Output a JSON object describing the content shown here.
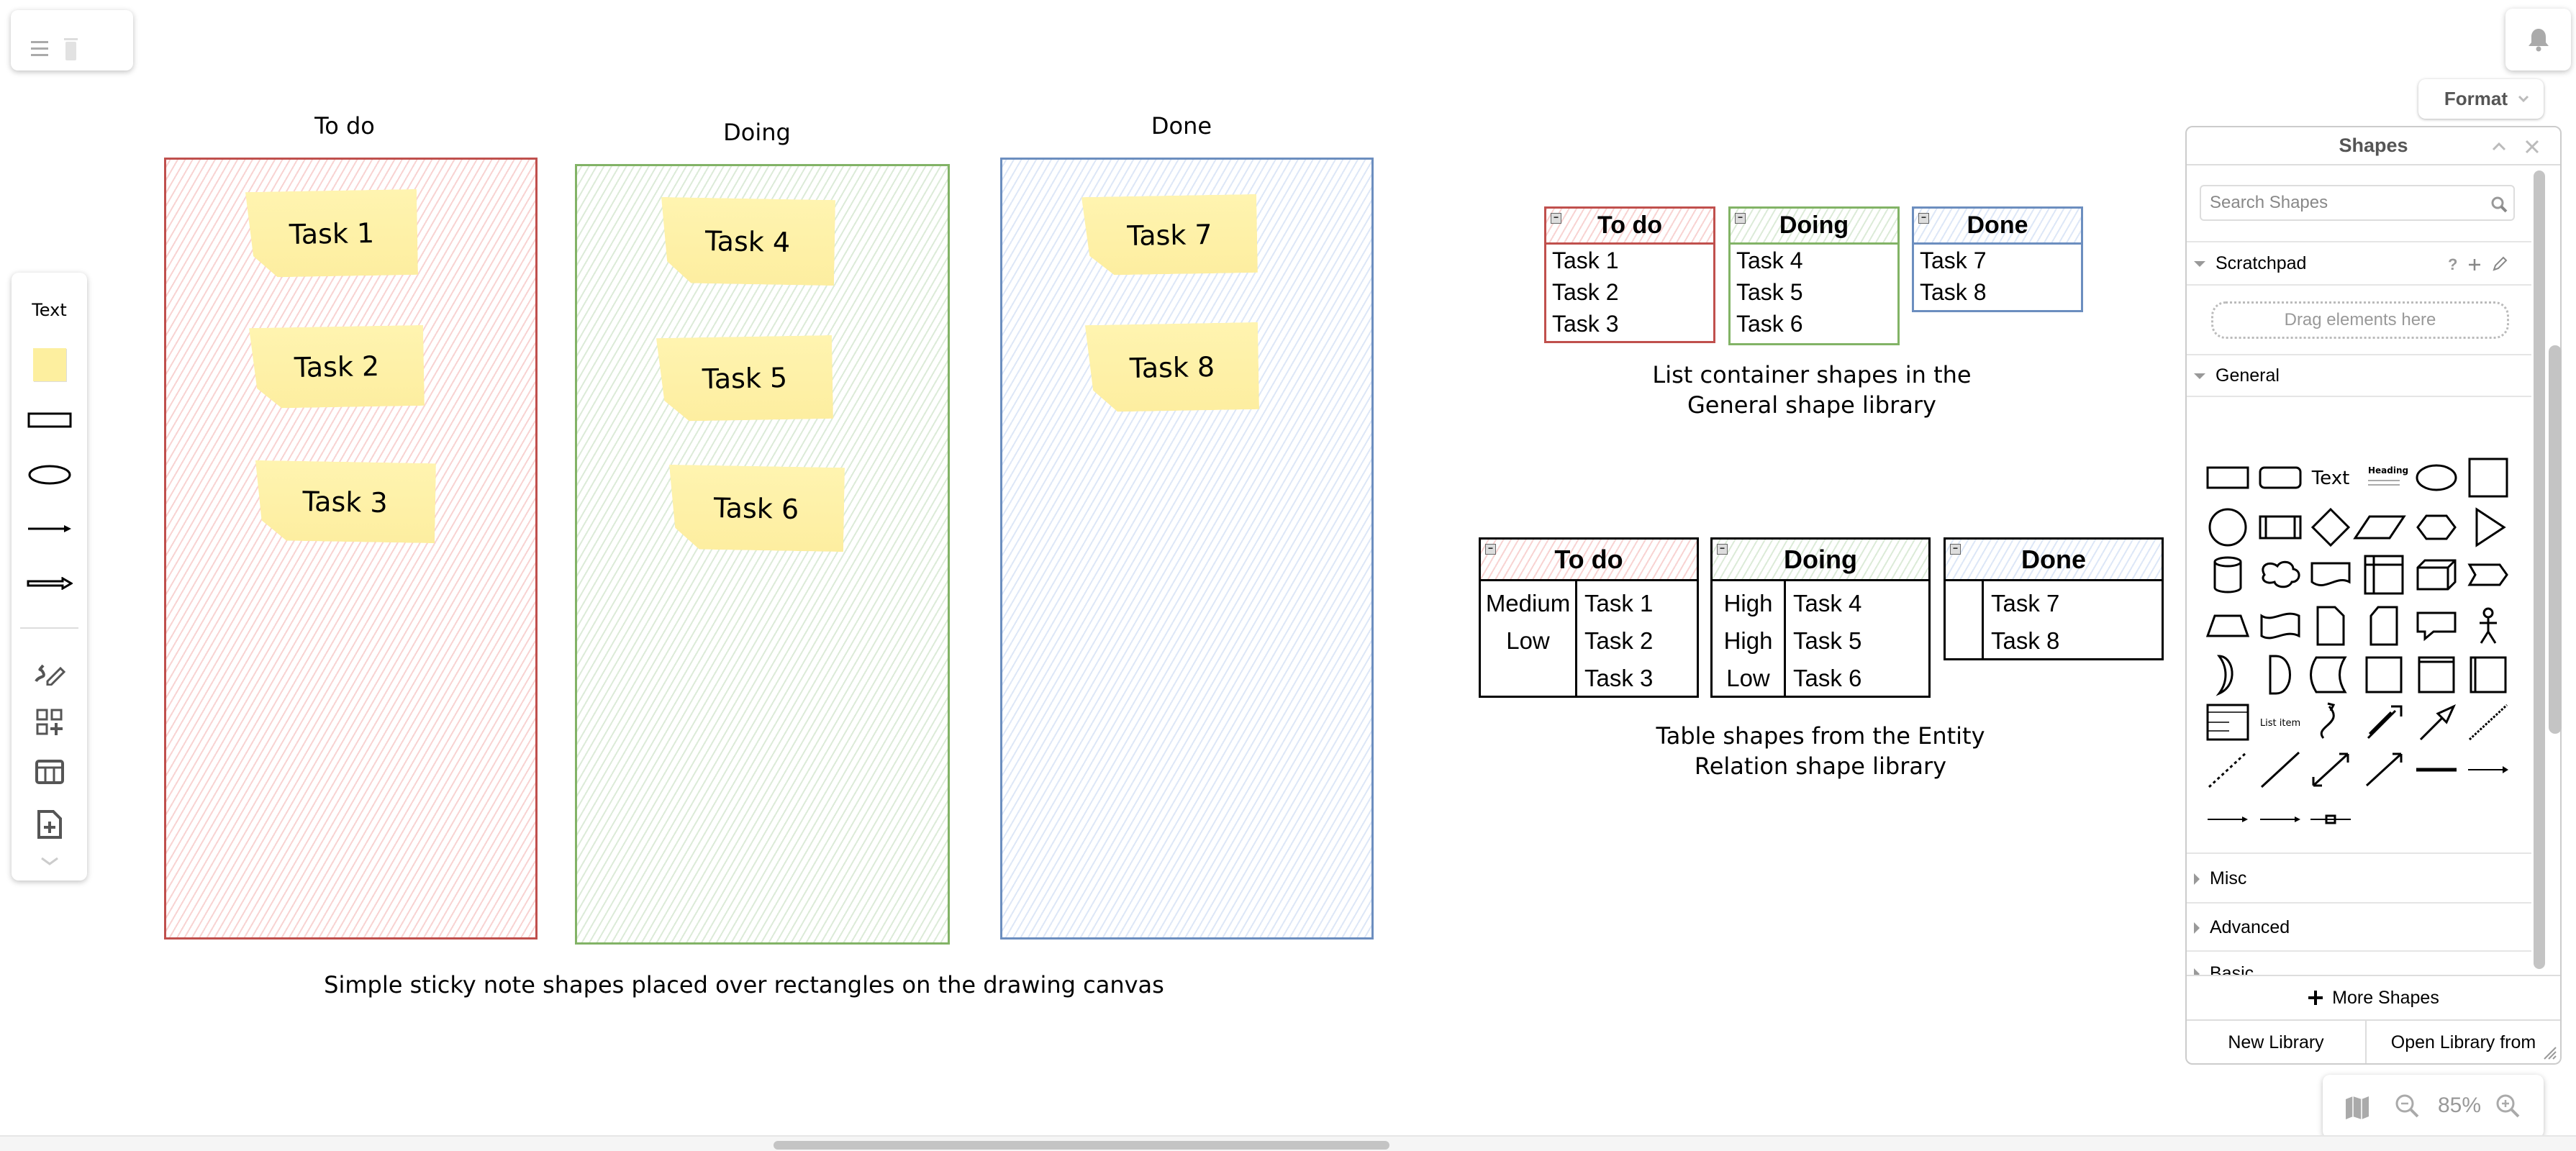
{
  "toolbar_top": {
    "icons": [
      "menu-icon",
      "trash-icon"
    ]
  },
  "notifications": {
    "icon": "bell-icon"
  },
  "format_button": {
    "label": "Format"
  },
  "board": {
    "columns": [
      {
        "title": "To do",
        "color": "#c0504d",
        "tasks": [
          "Task 1",
          "Task 2",
          "Task 3"
        ]
      },
      {
        "title": "Doing",
        "color": "#82b366",
        "tasks": [
          "Task 4",
          "Task 5",
          "Task 6"
        ]
      },
      {
        "title": "Done",
        "color": "#6c8ebf",
        "tasks": [
          "Task 7",
          "Task 8"
        ]
      }
    ],
    "caption": "Simple sticky note shapes placed over rectangles on the drawing canvas"
  },
  "lists": {
    "items": [
      {
        "title": "To do",
        "rows": [
          "Task 1",
          "Task 2",
          "Task 3"
        ]
      },
      {
        "title": "Doing",
        "rows": [
          "Task 4",
          "Task 5",
          "Task 6"
        ]
      },
      {
        "title": "Done",
        "rows": [
          "Task 7",
          "Task 8"
        ]
      }
    ],
    "caption_line1": "List container shapes in the",
    "caption_line2": "General shape library"
  },
  "tables": {
    "items": [
      {
        "title": "To do",
        "priorities": [
          "Medium",
          "Low",
          ""
        ],
        "tasks": [
          "Task 1",
          "Task 2",
          "Task 3"
        ]
      },
      {
        "title": "Doing",
        "priorities": [
          "High",
          "High",
          "Low"
        ],
        "tasks": [
          "Task 4",
          "Task 5",
          "Task 6"
        ]
      },
      {
        "title": "Done",
        "priorities": [
          "",
          ""
        ],
        "tasks": [
          "Task 7",
          "Task 8"
        ]
      }
    ],
    "caption_line1": "Table shapes from the Entity",
    "caption_line2": "Relation shape library"
  },
  "left_toolbar": {
    "text_label": "Text",
    "tools": [
      "sticky-note",
      "rectangle",
      "ellipse",
      "line-arrow",
      "block-arrow"
    ],
    "actions": [
      "freehand-icon",
      "shapes-plus-icon",
      "table-icon",
      "page-plus-icon",
      "chevron-down-icon"
    ]
  },
  "shapes_panel": {
    "title": "Shapes",
    "search_placeholder": "Search Shapes",
    "scratchpad": {
      "label": "Scratchpad",
      "help": "?",
      "drop_hint": "Drag elements here"
    },
    "general": {
      "label": "General",
      "text_shape": "Text",
      "heading_shape": "Heading",
      "list_item_shape": "List item"
    },
    "sections": [
      "Misc",
      "Advanced",
      "Basic"
    ],
    "more_shapes": "More Shapes",
    "new_library": "New Library",
    "open_library": "Open Library from"
  },
  "zoom": {
    "level": "85%"
  }
}
